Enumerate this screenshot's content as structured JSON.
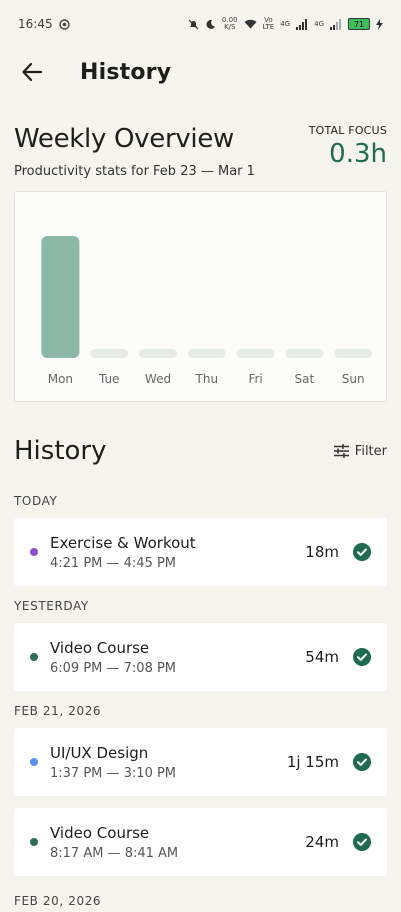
{
  "status_bar": {
    "time": "16:45",
    "net_speed_value": "0.00",
    "net_speed_unit": "K/S",
    "volte_top": "Vo",
    "volte_bottom": "LTE",
    "network_1": "4G",
    "network_2": "4G",
    "battery": "71"
  },
  "app_bar": {
    "title": "History"
  },
  "overview": {
    "title": "Weekly Overview",
    "subtitle": "Productivity stats for Feb 23 — Mar 1",
    "total_label": "TOTAL FOCUS",
    "total_value": "0.3h"
  },
  "chart_data": {
    "type": "bar",
    "categories": [
      "Mon",
      "Tue",
      "Wed",
      "Thu",
      "Fri",
      "Sat",
      "Sun"
    ],
    "values": [
      0.3,
      0,
      0,
      0,
      0,
      0,
      0
    ],
    "title": "",
    "xlabel": "",
    "ylabel": "",
    "ylim": [
      0,
      0.3
    ],
    "grid": false,
    "bar_color": "#8cb8a8",
    "empty_bar_color": "#e6ebe7"
  },
  "history": {
    "title": "History",
    "filter_label": "Filter",
    "groups": [
      {
        "label": "TODAY",
        "entries": [
          {
            "title": "Exercise & Workout",
            "time": "4:21 PM — 4:45 PM",
            "duration": "18m",
            "dot_color": "#8a55c9"
          }
        ]
      },
      {
        "label": "YESTERDAY",
        "entries": [
          {
            "title": "Video Course",
            "time": "6:09 PM — 7:08 PM",
            "duration": "54m",
            "dot_color": "#2f6d55"
          }
        ]
      },
      {
        "label": "FEB 21, 2026",
        "entries": [
          {
            "title": "UI/UX Design",
            "time": "1:37 PM — 3:10 PM",
            "duration": "1j 15m",
            "dot_color": "#5b8ff0"
          },
          {
            "title": "Video Course",
            "time": "8:17 AM — 8:41 AM",
            "duration": "24m",
            "dot_color": "#2f6d55"
          }
        ]
      },
      {
        "label": "FEB 20, 2026",
        "entries": []
      }
    ]
  },
  "colors": {
    "accent": "#1f6b4f",
    "check": "#1f6b4f"
  }
}
